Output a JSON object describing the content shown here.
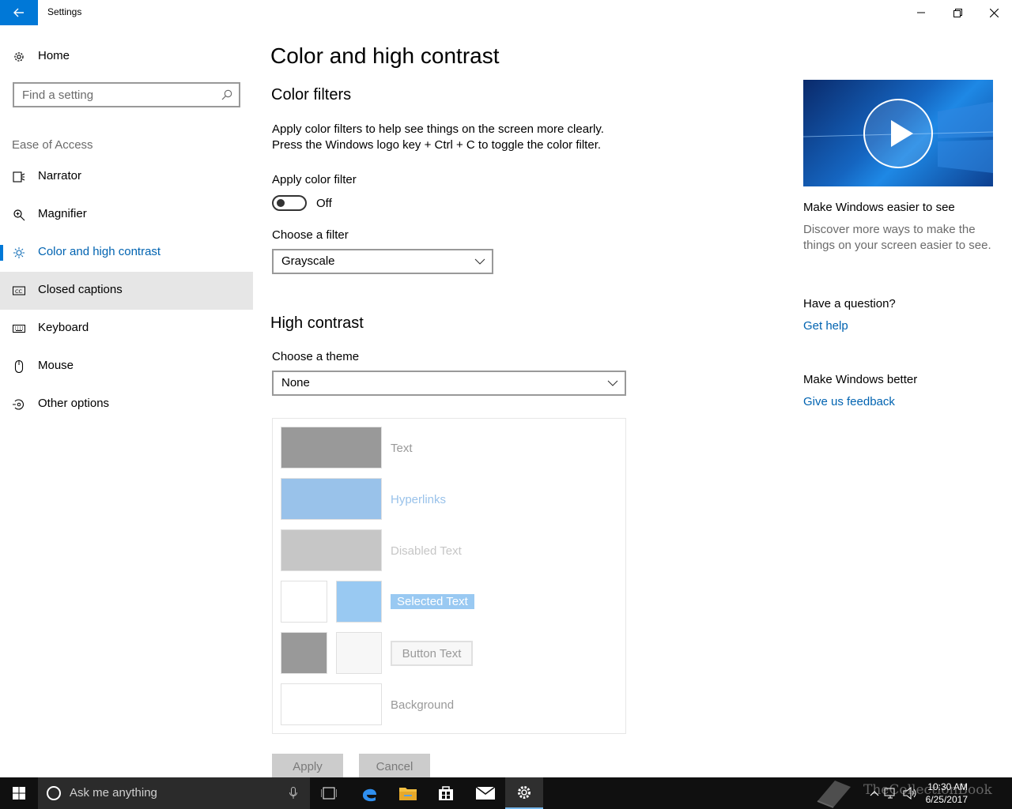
{
  "window": {
    "title": "Settings"
  },
  "sidebar": {
    "home_label": "Home",
    "search_placeholder": "Find a setting",
    "section_label": "Ease of Access",
    "items": [
      {
        "label": "Narrator",
        "icon": "narrator-icon"
      },
      {
        "label": "Magnifier",
        "icon": "magnifier-icon"
      },
      {
        "label": "Color and high contrast",
        "icon": "brightness-icon",
        "active": true
      },
      {
        "label": "Closed captions",
        "icon": "closed-captions-icon",
        "hover": true
      },
      {
        "label": "Keyboard",
        "icon": "keyboard-icon"
      },
      {
        "label": "Mouse",
        "icon": "mouse-icon"
      },
      {
        "label": "Other options",
        "icon": "other-options-icon"
      }
    ]
  },
  "main": {
    "page_title": "Color and high contrast",
    "color_filters": {
      "heading": "Color filters",
      "description_line1": "Apply color filters to help see things on the screen more clearly.",
      "description_line2": "Press the Windows logo key + Ctrl + C to toggle the color filter.",
      "apply_label": "Apply color filter",
      "toggle_state": "Off",
      "choose_filter_label": "Choose a filter",
      "filter_value": "Grayscale"
    },
    "high_contrast": {
      "heading": "High contrast",
      "choose_theme_label": "Choose a theme",
      "theme_value": "None",
      "preview": {
        "text": "Text",
        "hyperlinks": "Hyperlinks",
        "disabled_text": "Disabled Text",
        "selected_text": "Selected Text",
        "button_text": "Button Text",
        "background": "Background"
      },
      "apply_button": "Apply",
      "cancel_button": "Cancel"
    }
  },
  "right_pane": {
    "video_title": "Make Windows easier to see",
    "video_desc_line1": "Discover more ways to make the",
    "video_desc_line2": "things on your screen easier to see.",
    "question_heading": "Have a question?",
    "get_help": "Get help",
    "better_heading": "Make Windows better",
    "feedback": "Give us feedback"
  },
  "taskbar": {
    "search_placeholder": "Ask me anything",
    "time": "10:30 AM",
    "date": "6/25/2017",
    "watermark": "TheCollectionBook"
  },
  "colors": {
    "accent": "#0078d7",
    "link": "#0063b1",
    "swatch_text": "#999999",
    "swatch_hyperlink": "#99c2ea",
    "swatch_disabled": "#c6c6c6",
    "swatch_selected": "#99c9f2"
  }
}
